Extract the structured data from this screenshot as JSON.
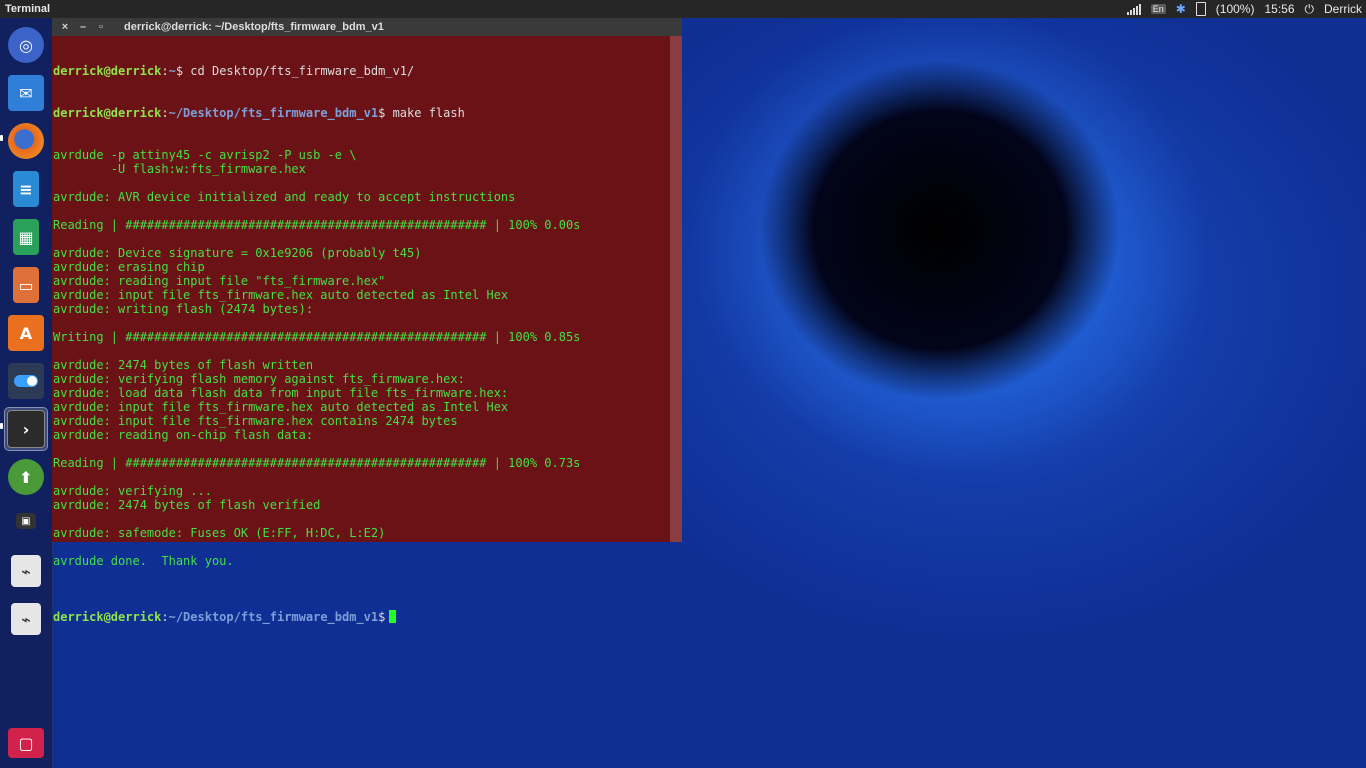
{
  "top_panel": {
    "app_title": "Terminal",
    "keyboard_layout": "En",
    "battery": "(100%)",
    "time": "15:56",
    "user": "Derrick"
  },
  "launcher": {
    "items": [
      {
        "name": "ubuntu-dash-icon",
        "color": "#3b63c8"
      },
      {
        "name": "mail-icon",
        "color": "#2f7fd8"
      },
      {
        "name": "firefox-icon",
        "color": "#e8671c"
      },
      {
        "name": "writer-icon",
        "color": "#2a8ad4"
      },
      {
        "name": "calc-icon",
        "color": "#2aa05a"
      },
      {
        "name": "impress-icon",
        "color": "#e0703a"
      },
      {
        "name": "software-center-icon",
        "color": "#e8701e"
      },
      {
        "name": "settings-toggle-icon",
        "color": "#2d3a55"
      },
      {
        "name": "terminal-icon",
        "color": "#2b2b2b"
      },
      {
        "name": "update-manager-icon",
        "color": "#4a9a3a"
      },
      {
        "name": "workspace-switcher-icon",
        "color": "#333333"
      },
      {
        "name": "usb-drive-icon",
        "color": "#e6e6e6"
      },
      {
        "name": "usb-drive-icon",
        "color": "#e6e6e6"
      },
      {
        "name": "trash-icon",
        "color": "#d0224a"
      }
    ]
  },
  "terminal": {
    "title": "derrick@derrick: ~/Desktop/fts_firmware_bdm_v1",
    "close_label": "×",
    "minimize_label": "–",
    "maximize_label": "▫",
    "user_host": "derrick@derrick",
    "cmd1_path": "~",
    "cmd1": "$ cd Desktop/fts_firmware_bdm_v1/",
    "cmd2_path": "~/Desktop/fts_firmware_bdm_v1",
    "cmd2": "$ make flash",
    "output": [
      "avrdude -p attiny45 -c avrisp2 -P usb -e \\",
      "        -U flash:w:fts_firmware.hex",
      "",
      "avrdude: AVR device initialized and ready to accept instructions",
      "",
      "Reading | ################################################## | 100% 0.00s",
      "",
      "avrdude: Device signature = 0x1e9206 (probably t45)",
      "avrdude: erasing chip",
      "avrdude: reading input file \"fts_firmware.hex\"",
      "avrdude: input file fts_firmware.hex auto detected as Intel Hex",
      "avrdude: writing flash (2474 bytes):",
      "",
      "Writing | ################################################## | 100% 0.85s",
      "",
      "avrdude: 2474 bytes of flash written",
      "avrdude: verifying flash memory against fts_firmware.hex:",
      "avrdude: load data flash data from input file fts_firmware.hex:",
      "avrdude: input file fts_firmware.hex auto detected as Intel Hex",
      "avrdude: input file fts_firmware.hex contains 2474 bytes",
      "avrdude: reading on-chip flash data:",
      "",
      "Reading | ################################################## | 100% 0.73s",
      "",
      "avrdude: verifying ...",
      "avrdude: 2474 bytes of flash verified",
      "",
      "avrdude: safemode: Fuses OK (E:FF, H:DC, L:E2)",
      "",
      "avrdude done.  Thank you.",
      ""
    ],
    "prompt_path": "~/Desktop/fts_firmware_bdm_v1",
    "prompt_symbol": "$"
  }
}
